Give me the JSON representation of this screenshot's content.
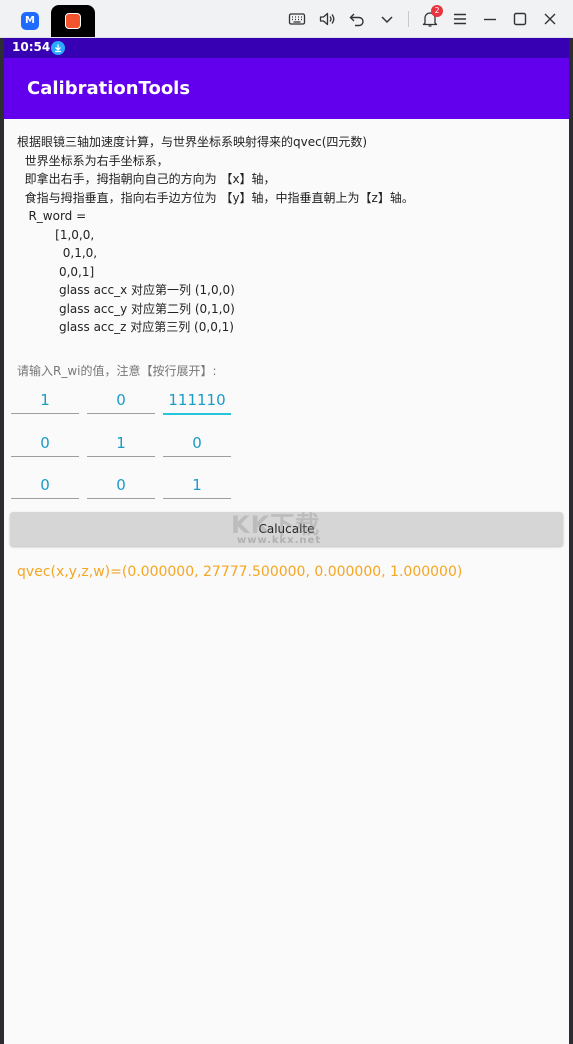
{
  "window": {
    "notification_count": "2",
    "icons": [
      "app-logo",
      "keyboard-icon",
      "volume-icon",
      "undo-icon",
      "chevron-down-icon",
      "bell-icon",
      "menu-icon",
      "minimize-icon",
      "maximize-icon",
      "close-icon"
    ]
  },
  "statusbar": {
    "time": "10:54"
  },
  "appbar": {
    "title": "CalibrationTools"
  },
  "description": "根据眼镜三轴加速度计算，与世界坐标系映射得来的qvec(四元数)\n  世界坐标系为右手坐标系，\n  即拿出右手，拇指朝向自己的方向为 【x】轴，\n  食指与拇指垂直，指向右手边方位为 【y】轴，中指垂直朝上为【z】轴。\n   R_word =\n          [1,0,0,\n            0,1,0,\n           0,0,1]\n           glass acc_x 对应第一列 (1,0,0)\n           glass acc_y 对应第二列 (0,1,0)\n           glass acc_z 对应第三列 (0,0,1)",
  "matrix": {
    "prompt": "请输入R_wi的值，注意【按行展开】:",
    "rows": [
      [
        "1",
        "0",
        "111110"
      ],
      [
        "0",
        "1",
        "0"
      ],
      [
        "0",
        "0",
        "1"
      ]
    ]
  },
  "calc_button": {
    "label": "Calucalte"
  },
  "watermark": {
    "main": "KK下载",
    "url": "www.kkx.net"
  },
  "result": "qvec(x,y,z,w)=(0.000000, 27777.500000, 0.000000, 1.000000)",
  "colors": {
    "status_bar": "#3700b3",
    "app_bar": "#6200ee",
    "input_text": "#1a9bc8",
    "result_text": "#f5a623"
  }
}
